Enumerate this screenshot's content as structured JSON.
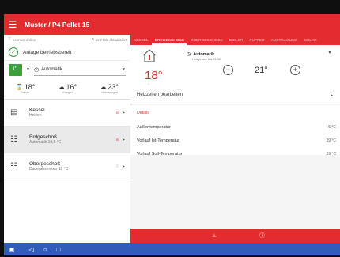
{
  "app": {
    "title": "Muster / P4 Pellet 15"
  },
  "status": {
    "connection": "connect online",
    "refresh": "in 2 Min aktualisiert"
  },
  "boiler": {
    "state": "Anlage betriebsbereit",
    "mode": "Automatik",
    "temps": [
      {
        "value": "18°",
        "label": "heute",
        "icon": "thermometer-icon"
      },
      {
        "value": "16°",
        "label": "morgen",
        "icon": "rain-cloud-icon"
      },
      {
        "value": "23°",
        "label": "übermorgen",
        "icon": "cloud-icon"
      }
    ]
  },
  "circuits": [
    {
      "name": "Kessel",
      "sub": "Heizen",
      "icon": "boiler-icon",
      "active": false
    },
    {
      "name": "Erdgeschoß",
      "sub": "Automatik 19,5 °C",
      "icon": "radiator-icon",
      "active": true
    },
    {
      "name": "Obergeschoß",
      "sub": "Dauerabsenken 18 °C",
      "icon": "radiator-icon",
      "active": false
    }
  ],
  "tabs": [
    "KESSEL",
    "ERDGESCHOSS",
    "OBERGESCHOSS",
    "BOILER",
    "PUFFER",
    "AUSTRAGUNG",
    "SOLAR"
  ],
  "zone": {
    "mode": "Automatik",
    "mode_sub": "Heizphase bis 21:30",
    "current_temp": "18°",
    "set_temp": "21°"
  },
  "menu": {
    "edit_times": "Heizzeiten bearbeiten"
  },
  "details": {
    "title": "Details",
    "rows": [
      {
        "label": "Außentemperatur",
        "value": "-5 °C"
      },
      {
        "label": "Vorlauf Ist-Temperatur",
        "value": "39 °C"
      },
      {
        "label": "Vorlauf Soll-Temperatur",
        "value": "39 °C"
      }
    ]
  },
  "colors": {
    "brand": "#e32b30",
    "ok": "#3a9b3a",
    "nav": "#2f5db9"
  }
}
